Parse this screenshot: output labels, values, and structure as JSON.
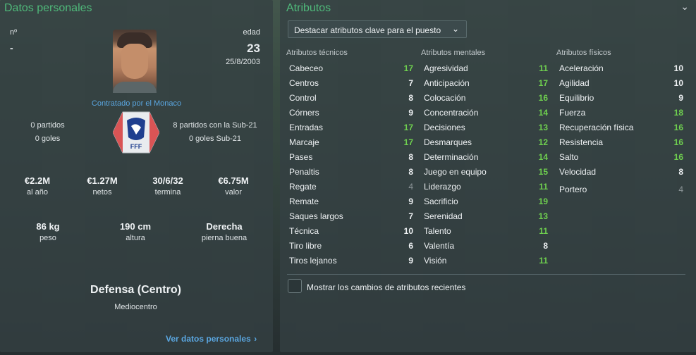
{
  "personal": {
    "title": "Datos personales",
    "number_label": "nº",
    "number_value": "-",
    "age_label": "edad",
    "age_value": "23",
    "birthdate": "25/8/2003",
    "contract": "Contratado por el Monaco",
    "senior_matches": "0 partidos",
    "senior_goals": "0 goles",
    "u21_matches": "8 partidos con la Sub-21",
    "u21_goals": "0 goles Sub-21",
    "finance": [
      {
        "value": "€2.2M",
        "label": "al año"
      },
      {
        "value": "€1.27M",
        "label": "netos"
      },
      {
        "value": "30/6/32",
        "label": "termina"
      },
      {
        "value": "€6.75M",
        "label": "valor"
      }
    ],
    "physical": [
      {
        "value": "86 kg",
        "label": "peso"
      },
      {
        "value": "190 cm",
        "label": "altura"
      },
      {
        "value": "Derecha",
        "label": "pierna buena"
      }
    ],
    "position_main": "Defensa (Centro)",
    "position_secondary": "Mediocentro",
    "more_link": "Ver datos personales",
    "badge_text": "FFF"
  },
  "attributes": {
    "title": "Atributos",
    "dropdown_label": "Destacar atributos clave para el puesto",
    "technical_header": "Atributos técnicos",
    "mental_header": "Atributos mentales",
    "physical_header": "Atributos físicos",
    "technical": [
      {
        "name": "Cabeceo",
        "value": "17",
        "color": "#6fd04f"
      },
      {
        "name": "Centros",
        "value": "7",
        "color": "#eef1f3"
      },
      {
        "name": "Control",
        "value": "8",
        "color": "#eef1f3"
      },
      {
        "name": "Córners",
        "value": "9",
        "color": "#eef1f3"
      },
      {
        "name": "Entradas",
        "value": "17",
        "color": "#6fd04f"
      },
      {
        "name": "Marcaje",
        "value": "17",
        "color": "#6fd04f"
      },
      {
        "name": "Pases",
        "value": "8",
        "color": "#eef1f3"
      },
      {
        "name": "Penaltis",
        "value": "8",
        "color": "#eef1f3"
      },
      {
        "name": "Regate",
        "value": "4",
        "color": "#8d9699"
      },
      {
        "name": "Remate",
        "value": "9",
        "color": "#eef1f3"
      },
      {
        "name": "Saques largos",
        "value": "7",
        "color": "#eef1f3"
      },
      {
        "name": "Técnica",
        "value": "10",
        "color": "#eef1f3"
      },
      {
        "name": "Tiro libre",
        "value": "6",
        "color": "#eef1f3"
      },
      {
        "name": "Tiros lejanos",
        "value": "9",
        "color": "#eef1f3"
      }
    ],
    "mental": [
      {
        "name": "Agresividad",
        "value": "11",
        "color": "#6fd04f"
      },
      {
        "name": "Anticipación",
        "value": "17",
        "color": "#6fd04f"
      },
      {
        "name": "Colocación",
        "value": "16",
        "color": "#6fd04f"
      },
      {
        "name": "Concentración",
        "value": "14",
        "color": "#6fd04f"
      },
      {
        "name": "Decisiones",
        "value": "13",
        "color": "#6fd04f"
      },
      {
        "name": "Desmarques",
        "value": "12",
        "color": "#6fd04f"
      },
      {
        "name": "Determinación",
        "value": "14",
        "color": "#6fd04f"
      },
      {
        "name": "Juego en equipo",
        "value": "15",
        "color": "#6fd04f"
      },
      {
        "name": "Liderazgo",
        "value": "11",
        "color": "#6fd04f"
      },
      {
        "name": "Sacrificio",
        "value": "19",
        "color": "#6fd04f"
      },
      {
        "name": "Serenidad",
        "value": "13",
        "color": "#6fd04f"
      },
      {
        "name": "Talento",
        "value": "11",
        "color": "#6fd04f"
      },
      {
        "name": "Valentía",
        "value": "8",
        "color": "#eef1f3"
      },
      {
        "name": "Visión",
        "value": "11",
        "color": "#6fd04f"
      }
    ],
    "physical": [
      {
        "name": "Aceleración",
        "value": "10",
        "color": "#eef1f3"
      },
      {
        "name": "Agilidad",
        "value": "10",
        "color": "#eef1f3"
      },
      {
        "name": "Equilibrio",
        "value": "9",
        "color": "#eef1f3"
      },
      {
        "name": "Fuerza",
        "value": "18",
        "color": "#6fd04f"
      },
      {
        "name": "Recuperación física",
        "value": "16",
        "color": "#6fd04f"
      },
      {
        "name": "Resistencia",
        "value": "16",
        "color": "#6fd04f"
      },
      {
        "name": "Salto",
        "value": "16",
        "color": "#6fd04f"
      },
      {
        "name": "Velocidad",
        "value": "8",
        "color": "#eef1f3"
      }
    ],
    "goalkeeper": {
      "name": "Portero",
      "value": "4",
      "color": "#8d9699"
    },
    "checkbox_label": "Mostrar los cambios de atributos recientes"
  }
}
